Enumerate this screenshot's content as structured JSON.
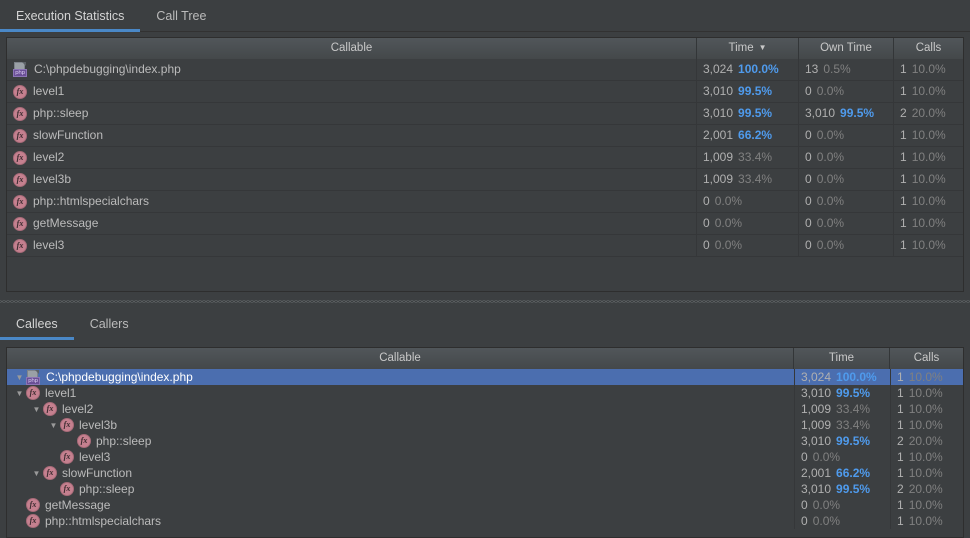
{
  "top_tabs": [
    {
      "label": "Execution Statistics",
      "active": true
    },
    {
      "label": "Call Tree",
      "active": false
    }
  ],
  "bottom_tabs": [
    {
      "label": "Callees",
      "active": true
    },
    {
      "label": "Callers",
      "active": false
    }
  ],
  "stats_table": {
    "headers": {
      "callable": "Callable",
      "time": "Time",
      "time_sort_arrow": "▼",
      "own_time": "Own Time",
      "calls": "Calls"
    },
    "rows": [
      {
        "icon": "php-file-icon",
        "name": "C:\\phpdebugging\\index.php",
        "time": "3,024",
        "time_pct": "100.0%",
        "time_hl": true,
        "own": "13",
        "own_pct": "0.5%",
        "own_hl": false,
        "calls": "1",
        "calls_pct": "10.0%"
      },
      {
        "icon": "fx-icon",
        "name": "level1",
        "time": "3,010",
        "time_pct": "99.5%",
        "time_hl": true,
        "own": "0",
        "own_pct": "0.0%",
        "own_hl": false,
        "calls": "1",
        "calls_pct": "10.0%"
      },
      {
        "icon": "fx-icon",
        "name": "php::sleep",
        "time": "3,010",
        "time_pct": "99.5%",
        "time_hl": true,
        "own": "3,010",
        "own_pct": "99.5%",
        "own_hl": true,
        "calls": "2",
        "calls_pct": "20.0%"
      },
      {
        "icon": "fx-icon",
        "name": "slowFunction",
        "time": "2,001",
        "time_pct": "66.2%",
        "time_hl": true,
        "own": "0",
        "own_pct": "0.0%",
        "own_hl": false,
        "calls": "1",
        "calls_pct": "10.0%"
      },
      {
        "icon": "fx-icon",
        "name": "level2",
        "time": "1,009",
        "time_pct": "33.4%",
        "time_hl": false,
        "own": "0",
        "own_pct": "0.0%",
        "own_hl": false,
        "calls": "1",
        "calls_pct": "10.0%"
      },
      {
        "icon": "fx-icon",
        "name": "level3b",
        "time": "1,009",
        "time_pct": "33.4%",
        "time_hl": false,
        "own": "0",
        "own_pct": "0.0%",
        "own_hl": false,
        "calls": "1",
        "calls_pct": "10.0%"
      },
      {
        "icon": "fx-icon",
        "name": "php::htmlspecialchars",
        "time": "0",
        "time_pct": "0.0%",
        "time_hl": false,
        "own": "0",
        "own_pct": "0.0%",
        "own_hl": false,
        "calls": "1",
        "calls_pct": "10.0%"
      },
      {
        "icon": "fx-icon",
        "name": "getMessage",
        "time": "0",
        "time_pct": "0.0%",
        "time_hl": false,
        "own": "0",
        "own_pct": "0.0%",
        "own_hl": false,
        "calls": "1",
        "calls_pct": "10.0%"
      },
      {
        "icon": "fx-icon",
        "name": "level3",
        "time": "0",
        "time_pct": "0.0%",
        "time_hl": false,
        "own": "0",
        "own_pct": "0.0%",
        "own_hl": false,
        "calls": "1",
        "calls_pct": "10.0%"
      }
    ]
  },
  "callees_tree": {
    "headers": {
      "callable": "Callable",
      "time": "Time",
      "calls": "Calls"
    },
    "rows": [
      {
        "depth": 0,
        "twisty": "▼",
        "icon": "php-file-icon",
        "name": "C:\\phpdebugging\\index.php",
        "selected": true,
        "time": "3,024",
        "time_pct": "100.0%",
        "time_hl": true,
        "calls": "1",
        "calls_pct": "10.0%"
      },
      {
        "depth": 0,
        "twisty": "▼",
        "icon": "fx-icon",
        "name": "level1",
        "selected": false,
        "time": "3,010",
        "time_pct": "99.5%",
        "time_hl": true,
        "calls": "1",
        "calls_pct": "10.0%"
      },
      {
        "depth": 1,
        "twisty": "▼",
        "icon": "fx-icon",
        "name": "level2",
        "selected": false,
        "time": "1,009",
        "time_pct": "33.4%",
        "time_hl": false,
        "calls": "1",
        "calls_pct": "10.0%"
      },
      {
        "depth": 2,
        "twisty": "▼",
        "icon": "fx-icon",
        "name": "level3b",
        "selected": false,
        "time": "1,009",
        "time_pct": "33.4%",
        "time_hl": false,
        "calls": "1",
        "calls_pct": "10.0%"
      },
      {
        "depth": 3,
        "twisty": "",
        "icon": "fx-icon",
        "name": "php::sleep",
        "selected": false,
        "time": "3,010",
        "time_pct": "99.5%",
        "time_hl": true,
        "calls": "2",
        "calls_pct": "20.0%"
      },
      {
        "depth": 2,
        "twisty": "",
        "icon": "fx-icon",
        "name": "level3",
        "selected": false,
        "time": "0",
        "time_pct": "0.0%",
        "time_hl": false,
        "calls": "1",
        "calls_pct": "10.0%"
      },
      {
        "depth": 1,
        "twisty": "▼",
        "icon": "fx-icon",
        "name": "slowFunction",
        "selected": false,
        "time": "2,001",
        "time_pct": "66.2%",
        "time_hl": true,
        "calls": "1",
        "calls_pct": "10.0%"
      },
      {
        "depth": 2,
        "twisty": "",
        "icon": "fx-icon",
        "name": "php::sleep",
        "selected": false,
        "time": "3,010",
        "time_pct": "99.5%",
        "time_hl": true,
        "calls": "2",
        "calls_pct": "20.0%"
      },
      {
        "depth": 0,
        "twisty": "",
        "icon": "fx-icon",
        "name": "getMessage",
        "selected": false,
        "time": "0",
        "time_pct": "0.0%",
        "time_hl": false,
        "calls": "1",
        "calls_pct": "10.0%"
      },
      {
        "depth": 0,
        "twisty": "",
        "icon": "fx-icon",
        "name": "php::htmlspecialchars",
        "selected": false,
        "time": "0",
        "time_pct": "0.0%",
        "time_hl": false,
        "calls": "1",
        "calls_pct": "10.0%"
      }
    ]
  },
  "icon_glyphs": {
    "fx": "fx",
    "php_badge": "php"
  },
  "colors": {
    "accent": "#4a88c7",
    "selection": "#4b6eaf",
    "highlight_pct": "#4f9bed",
    "background": "#3c3f41",
    "header": "#4b4f51"
  }
}
